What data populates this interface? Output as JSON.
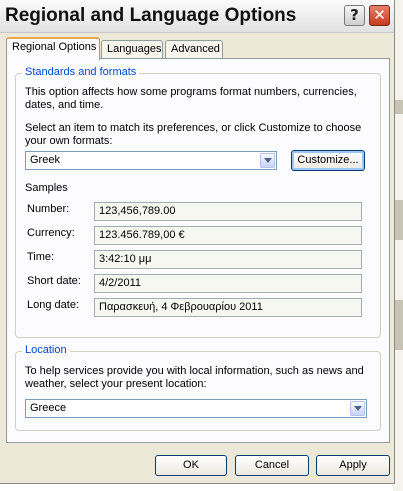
{
  "window": {
    "title": "Regional and Language Options"
  },
  "titlebar": {
    "help_glyph": "?",
    "close_glyph": "✕"
  },
  "tabs": [
    {
      "label": "Regional Options",
      "active": true
    },
    {
      "label": "Languages",
      "active": false
    },
    {
      "label": "Advanced",
      "active": false
    }
  ],
  "standards": {
    "group_title": "Standards and formats",
    "description": [
      "This option affects how some programs format numbers, currencies,",
      "dates, and time."
    ],
    "select_prompt": [
      "Select an item to match its preferences, or click Customize to choose",
      "your own formats:"
    ],
    "format_value": "Greek",
    "customize_label": "Customize...",
    "samples_label": "Samples",
    "samples": [
      {
        "label": "Number:",
        "value": "123,456,789.00"
      },
      {
        "label": "Currency:",
        "value": "123.456.789,00 €"
      },
      {
        "label": "Time:",
        "value": "3:42:10 μμ"
      },
      {
        "label": "Short date:",
        "value": "4/2/2011"
      },
      {
        "label": "Long date:",
        "value": "Παρασκευή, 4 Φεβρουαρίου 2011"
      }
    ]
  },
  "location": {
    "group_title": "Location",
    "description": [
      "To help services provide you with local information, such as news and",
      "weather, select your present location:"
    ],
    "value": "Greece"
  },
  "buttons": {
    "ok": "OK",
    "cancel": "Cancel",
    "apply": "Apply"
  }
}
